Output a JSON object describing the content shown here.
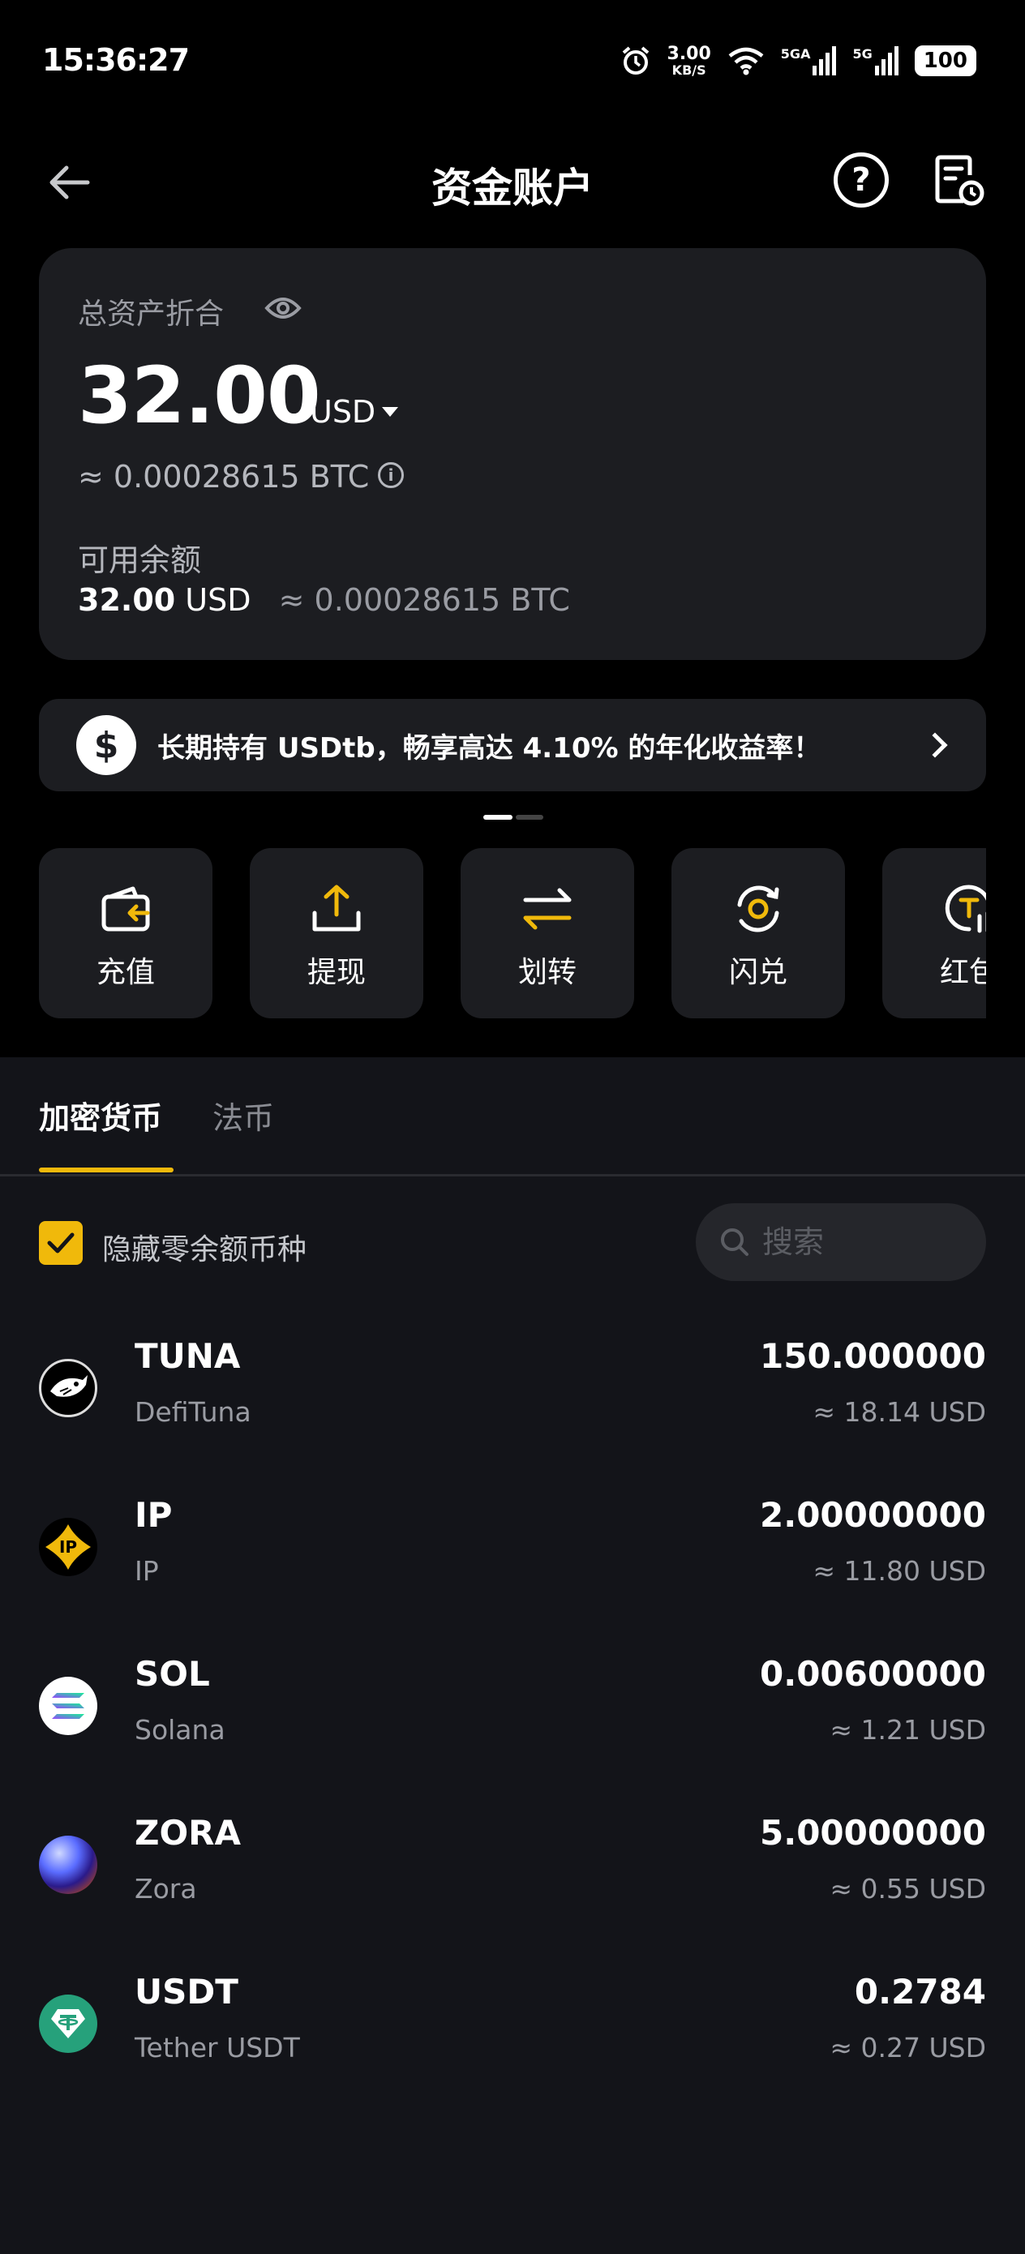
{
  "status_bar": {
    "time": "15:36:27",
    "net_speed": "3.00",
    "net_unit": "KB/S",
    "sig1": "5GA",
    "sig2": "5G",
    "battery": "100"
  },
  "header": {
    "title": "资金账户"
  },
  "balance": {
    "total_label": "总资产折合",
    "total_value": "32.00",
    "currency": "USD",
    "btc_approx": "≈ 0.00028615 BTC",
    "available_label": "可用余额",
    "available_value": "32.00",
    "available_currency": "USD",
    "available_btc": "≈ 0.00028615 BTC"
  },
  "promo": {
    "text": "长期持有 USDtb，畅享高达 4.10% 的年化收益率！"
  },
  "actions": [
    {
      "label": "充值",
      "icon": "deposit-icon"
    },
    {
      "label": "提现",
      "icon": "withdraw-icon"
    },
    {
      "label": "划转",
      "icon": "transfer-icon"
    },
    {
      "label": "闪兑",
      "icon": "convert-icon"
    },
    {
      "label": "红包",
      "icon": "red-packet-icon"
    }
  ],
  "tabs": [
    {
      "label": "加密货币",
      "active": true
    },
    {
      "label": "法币",
      "active": false
    }
  ],
  "filter": {
    "hide_zero_label": "隐藏零余额币种",
    "hide_zero_checked": true,
    "search_placeholder": "搜索"
  },
  "assets": [
    {
      "symbol": "TUNA",
      "name": "DefiTuna",
      "amount": "150.000000",
      "usd": "≈ 18.14 USD"
    },
    {
      "symbol": "IP",
      "name": "IP",
      "amount": "2.00000000",
      "usd": "≈ 11.80 USD"
    },
    {
      "symbol": "SOL",
      "name": "Solana",
      "amount": "0.00600000",
      "usd": "≈ 1.21 USD"
    },
    {
      "symbol": "ZORA",
      "name": "Zora",
      "amount": "5.00000000",
      "usd": "≈ 0.55 USD"
    },
    {
      "symbol": "USDT",
      "name": "Tether USDT",
      "amount": "0.2784",
      "usd": "≈ 0.27 USD"
    }
  ],
  "colors": {
    "accent": "#f0b90b",
    "card": "#1c1d21",
    "panel": "#131419"
  }
}
